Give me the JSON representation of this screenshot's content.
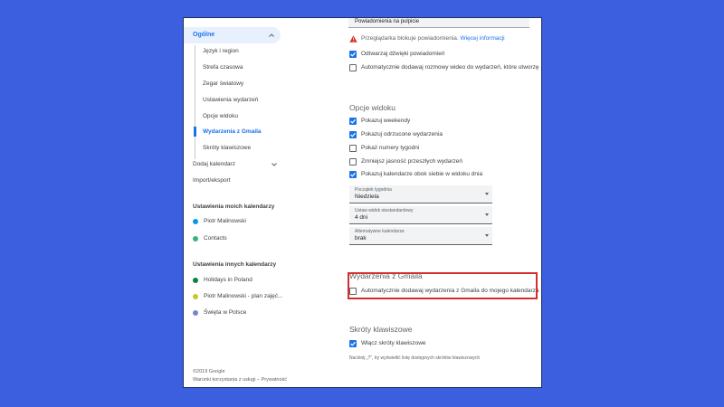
{
  "colors": {
    "background": "#3c5fe0",
    "accent": "#1a73e8",
    "highlight": "#d32f2f",
    "warning": "#d93025"
  },
  "sidebar": {
    "general": {
      "label": "Ogólne",
      "icon": "chevron-up-icon"
    },
    "sub_items": [
      {
        "label": "Język i region"
      },
      {
        "label": "Strefa czasowa"
      },
      {
        "label": "Zegar światowy"
      },
      {
        "label": "Ustawienia wydarzeń"
      },
      {
        "label": "Opcje widoku"
      },
      {
        "label": "Wydarzenia z Gmaila",
        "active": true
      },
      {
        "label": "Skróty klawiszowe"
      }
    ],
    "add_calendar": {
      "label": "Dodaj kalendarz",
      "icon": "chevron-down-icon"
    },
    "import_export": "Import/eksport",
    "my_calendars_heading": "Ustawienia moich kalendarzy",
    "my_calendars": [
      {
        "label": "Piotr Malinowski",
        "color": "#039be5"
      },
      {
        "label": "Contacts",
        "color": "#33b679"
      }
    ],
    "other_calendars_heading": "Ustawienia innych kalendarzy",
    "other_calendars": [
      {
        "label": "Holidays in Poland",
        "color": "#0b8043"
      },
      {
        "label": "Piotr Malinowski - plan zajęć...",
        "color": "#c0ca33"
      },
      {
        "label": "Święta w Polsce",
        "color": "#7986cb"
      }
    ],
    "footer": {
      "copyright": "©2019 Google",
      "terms": "Warunki korzystania z usługi",
      "separator": " – ",
      "privacy": "Prywatność"
    }
  },
  "main": {
    "notification_select_value": "Powiadomienia na pulpicie",
    "warning": {
      "text": "Przeglądarka blokuje powiadomienia.",
      "link": "Więcej informacji",
      "icon": "warning-icon"
    },
    "event_options": [
      {
        "label": "Odtwarzaj dźwięki powiadomień",
        "checked": true
      },
      {
        "label": "Automatycznie dodawaj rozmowy wideo do wydarzeń, które utworzę",
        "checked": false
      }
    ],
    "view_options": {
      "title": "Opcje widoku",
      "items": [
        {
          "label": "Pokazuj weekendy",
          "checked": true
        },
        {
          "label": "Pokazuj odrzucone wydarzenia",
          "checked": true
        },
        {
          "label": "Pokaż numery tygodni",
          "checked": false
        },
        {
          "label": "Zmniejsz jasność przeszłych wydarzeń",
          "checked": false
        },
        {
          "label": "Pokazuj kalendarze obok siebie w widoku dnia",
          "checked": true
        }
      ],
      "selects": [
        {
          "label": "Początek tygodnia",
          "value": "Niedziela"
        },
        {
          "label": "Ustaw widok niestandardowy",
          "value": "4 dni"
        },
        {
          "label": "Alternatywne kalendarze",
          "value": "brak"
        }
      ]
    },
    "gmail_events": {
      "title": "Wydarzenia z Gmaila",
      "item": {
        "label": "Automatycznie dodawaj wydarzenia z Gmaila do mojego kalendarza",
        "checked": false
      }
    },
    "shortcuts": {
      "title": "Skróty klawiszowe",
      "item": {
        "label": "Włącz skróty klawiszowe",
        "checked": true
      },
      "hint": "Naciśnij „?”, by wyświetlić listę dostępnych skrótów klawiszowych"
    }
  }
}
